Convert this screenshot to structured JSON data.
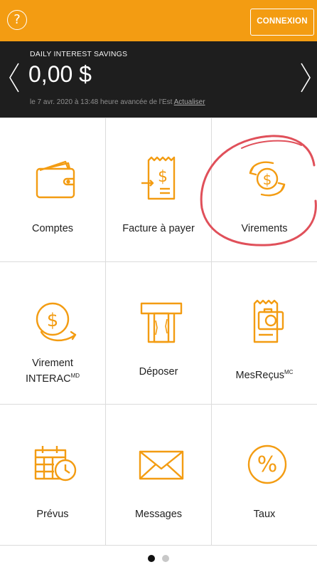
{
  "header": {
    "help_symbol": "?",
    "login_label": "CONNEXION"
  },
  "balance": {
    "account_name": "DAILY INTEREST SAVINGS",
    "amount": "0,00 $",
    "updated_text": "le 7 avr. 2020 à 13:48 heure avancée de l'Est",
    "refresh_label": "Actualiser"
  },
  "tiles": [
    {
      "label": "Comptes",
      "icon": "wallet-icon"
    },
    {
      "label": "Facture à payer",
      "icon": "bill-icon"
    },
    {
      "label": "Virements",
      "icon": "transfer-icon"
    },
    {
      "label_line1": "Virement",
      "label_line2": "INTERAC",
      "sup": "MD",
      "icon": "interac-icon"
    },
    {
      "label": "Déposer",
      "icon": "atm-deposit-icon"
    },
    {
      "label": "MesReçus",
      "sup": "MC",
      "icon": "receipt-camera-icon"
    },
    {
      "label": "Prévus",
      "icon": "calendar-clock-icon"
    },
    {
      "label": "Messages",
      "icon": "envelope-icon"
    },
    {
      "label": "Taux",
      "icon": "percent-icon"
    }
  ],
  "colors": {
    "accent": "#f39c12",
    "panel": "#1e1e1e",
    "annotation": "#e0505a"
  }
}
